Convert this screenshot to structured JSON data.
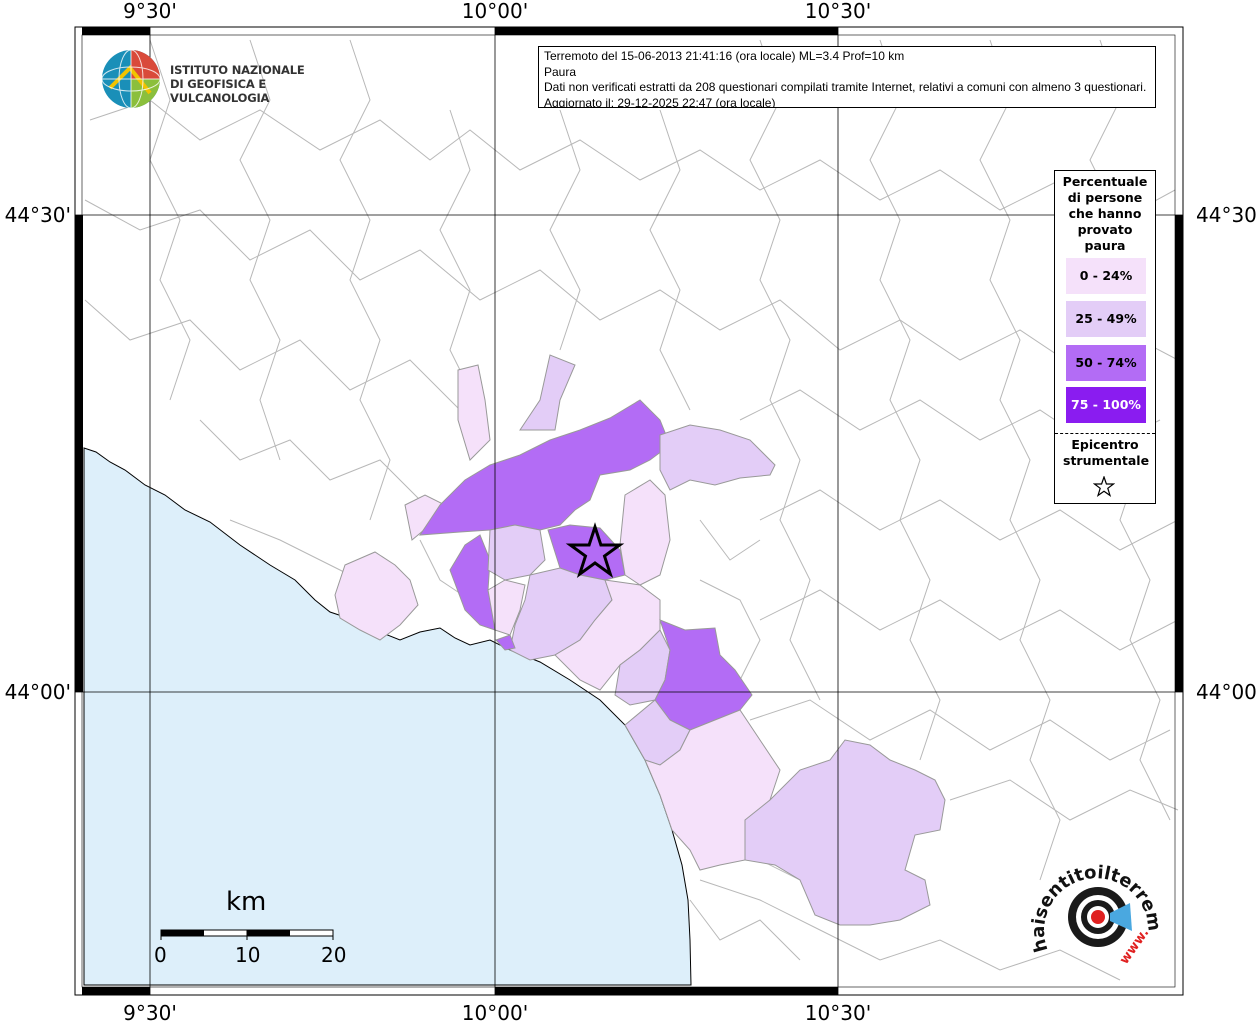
{
  "logo": {
    "line1": "ISTITUTO NAZIONALE",
    "line2": "DI GEOFISICA E VULCANOLOGIA"
  },
  "info": {
    "line1": "Terremoto del 15-06-2013 21:41:16 (ora locale) ML=3.4 Prof=10 km",
    "line2": "Paura",
    "line3": "Dati non verificati estratti da 208 questionari compilati tramite Internet, relativi a comuni con almeno 3 questionari.",
    "line4": "Aggiornato il: 29-12-2025 22:47 (ora locale)"
  },
  "axes": {
    "lon_labels": [
      "9°30'",
      "10°00'",
      "10°30'"
    ],
    "lat_labels": [
      "44°30'",
      "44°00'"
    ]
  },
  "legend": {
    "title": "Percentuale di persone che hanno provato paura",
    "classes": [
      {
        "label": "0 - 24%",
        "color": "#f5e1fa"
      },
      {
        "label": "25 - 49%",
        "color": "#e3cdf7"
      },
      {
        "label": "50 - 74%",
        "color": "#b36cf5"
      },
      {
        "label": "75 - 100%",
        "color": "#8a1cf0"
      }
    ],
    "epicenter_label": "Epicentro strumentale"
  },
  "scale": {
    "unit": "km",
    "labels": [
      "0",
      "10",
      "20"
    ]
  },
  "brand": {
    "text": "haisentitoilterremoto.it",
    "url": "www."
  },
  "colors": {
    "sea": "#ddeffa",
    "land": "#ffffff",
    "border": "#b4b4b4",
    "class1": "#f5e1fa",
    "class2": "#e3cdf7",
    "class3": "#b36cf5",
    "class4": "#8a1cf0"
  }
}
